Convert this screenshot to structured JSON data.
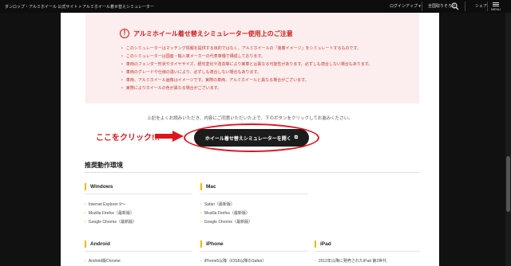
{
  "topbar": {
    "breadcrumb": "ダンロップ・アルミホイール 公式サイト > アルミホイール着せ替えシミュレーター",
    "login_label": "ログインアップ ▾",
    "search_label": "全国取りそろえ",
    "share_label": "シェア",
    "menu_label": "MENU"
  },
  "notice": {
    "title": "アルミホイール着せ替えシミュレーター使用上のご注意",
    "items": [
      "このシミュレーターはマッチング情報を提供する目的ではなく、アルミホイールの「装着イメージ」をシミュレートするものです。",
      "このシミュレーターは国産・輸入車メーカーの代表車種で構成しております。",
      "車両のフェンダー形状やタイヤサイズ、経年変化や改造等により実車とは異なる可能性があります。必ずしも適合しない場合もあります。",
      "車両のグレードや仕様の違いにより、必ずしも適合しない場合もあります。",
      "車両、アルミホイール画像はイメージです。実際の車両、アルミホイールと異なる場合がございます。",
      "実際によりホイールの色が異なる場合がございます。"
    ]
  },
  "intro_text": "上記をよくお読みいただき、内容にご同意いただいた上で、下のボタンをクリックしてお進みください。",
  "click_label": "ここをクリック!!!",
  "simulator_button": {
    "label": "ホイール着せ替えシミュレーターを開く"
  },
  "recommended": {
    "title": "推奨動作環境",
    "columns": [
      {
        "name": "Windows",
        "items": [
          "Internet Explorer 9～",
          "Mozilla Firefox（最新版）",
          "Google Chrome（最新版）"
        ]
      },
      {
        "name": "Mac",
        "items": [
          "Safari（最新版）",
          "Mozilla Firefox（最新版）",
          "Google Chrome（最新版）"
        ]
      },
      {
        "name": "Android",
        "items": [
          "Android版Chrome"
        ]
      },
      {
        "name": "iPhone",
        "items": [
          "iPhone5以降（iOS8以降のSafari）"
        ]
      },
      {
        "name": "iPad",
        "items": [
          "2012年以降に発売されたiPad 第3世代"
        ]
      }
    ]
  },
  "colors": {
    "accent_red": "#e0141e",
    "notice_bg": "#fceeee",
    "bullet_yellow": "#f2b705",
    "topbar": "#0d0d0d"
  }
}
